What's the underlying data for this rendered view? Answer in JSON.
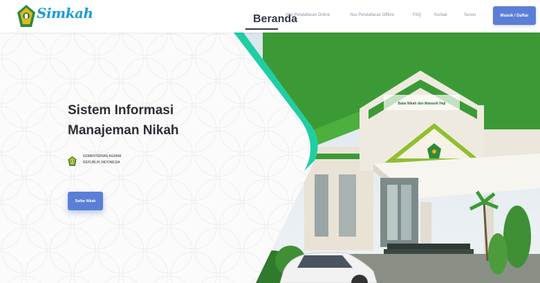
{
  "header": {
    "logo_text": "Simkah",
    "nav": [
      {
        "label": "Beranda",
        "active": true
      },
      {
        "label": "Alur Pendaftaran Online",
        "active": false
      },
      {
        "label": "Alur Pendaftaran Offline",
        "active": false
      },
      {
        "label": "FAQ",
        "active": false
      },
      {
        "label": "Kontak",
        "active": false
      },
      {
        "label": "Survei",
        "active": false
      }
    ],
    "login_label": "Masuk / Daftar"
  },
  "hero": {
    "title_line1": "Sistem Informasi",
    "title_line2": "Manajeman Nikah",
    "ministry_line1": "KEMENTERIAN AGAMA",
    "ministry_line2": "REPUBLIK INDONESIA",
    "cta_label": "Daftar Nikah",
    "building_sign": "Balai Nikah dan Manasik Haji"
  },
  "colors": {
    "primary": "#5b7fd6",
    "logo_blue": "#1e9bd7",
    "accent_teal": "#1fcfa3",
    "accent_pink": "#ef6f8a",
    "roof_green": "#3c9a36",
    "ministry_green": "#2e8b3a",
    "ministry_gold": "#e6b422"
  },
  "icons": {
    "logo": "kemenag-emblem-icon",
    "ministry": "kemenag-emblem-icon"
  }
}
